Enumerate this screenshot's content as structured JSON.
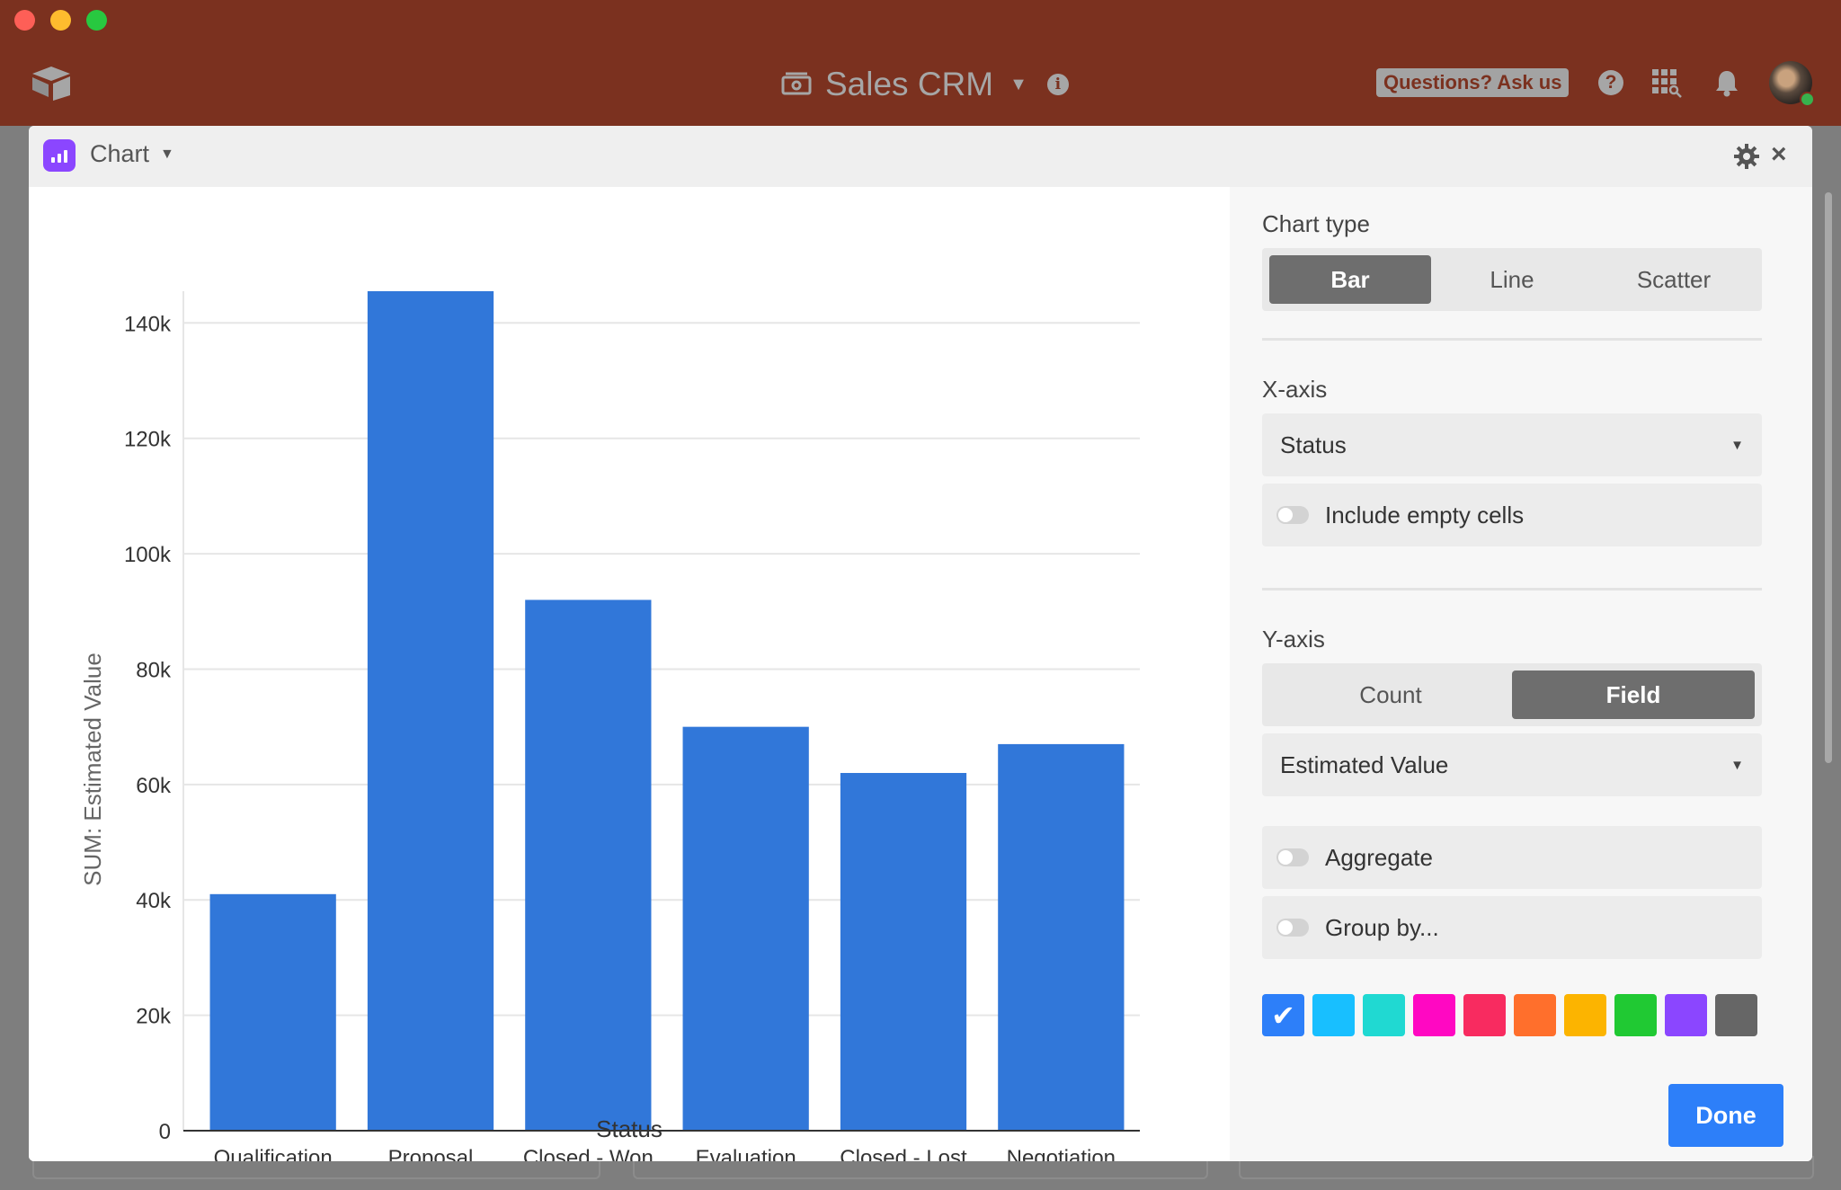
{
  "window": {
    "title": "Sales CRM"
  },
  "header": {
    "base_name": "Sales CRM",
    "questions_label": "Questions? Ask us",
    "help_label": "?"
  },
  "modal": {
    "title": "Chart",
    "close_label": "×"
  },
  "chart_data": {
    "type": "bar",
    "categories": [
      "Qualification",
      "Proposal",
      "Closed - Won",
      "Evaluation",
      "Closed - Lost",
      "Negotiation"
    ],
    "values": [
      41000,
      145500,
      92000,
      70000,
      62000,
      67000
    ],
    "xlabel": "Status",
    "ylabel": "SUM: Estimated Value",
    "ylim": [
      0,
      145500
    ],
    "yticks": [
      0,
      20000,
      40000,
      60000,
      80000,
      100000,
      120000,
      140000
    ],
    "ytick_labels": [
      "0",
      "20k",
      "40k",
      "60k",
      "80k",
      "100k",
      "120k",
      "140k"
    ],
    "grid": true,
    "bar_color": "#3177d9"
  },
  "sidebar": {
    "chart_type_label": "Chart type",
    "chart_types": [
      "Bar",
      "Line",
      "Scatter"
    ],
    "chart_type_selected": "Bar",
    "x_axis_label": "X-axis",
    "x_field": "Status",
    "include_empty_label": "Include empty cells",
    "y_axis_label": "Y-axis",
    "y_modes": [
      "Count",
      "Field"
    ],
    "y_mode_selected": "Field",
    "y_field": "Estimated Value",
    "aggregate_label": "Aggregate",
    "group_by_label": "Group by...",
    "colors": [
      "#2d7ff9",
      "#18bfff",
      "#20d9d2",
      "#ff08c2",
      "#f82b60",
      "#ff6f2c",
      "#fcb400",
      "#20c933",
      "#8b46ff",
      "#666666"
    ],
    "selected_color": "#2d7ff9",
    "check_glyph": "✔",
    "done_label": "Done"
  }
}
